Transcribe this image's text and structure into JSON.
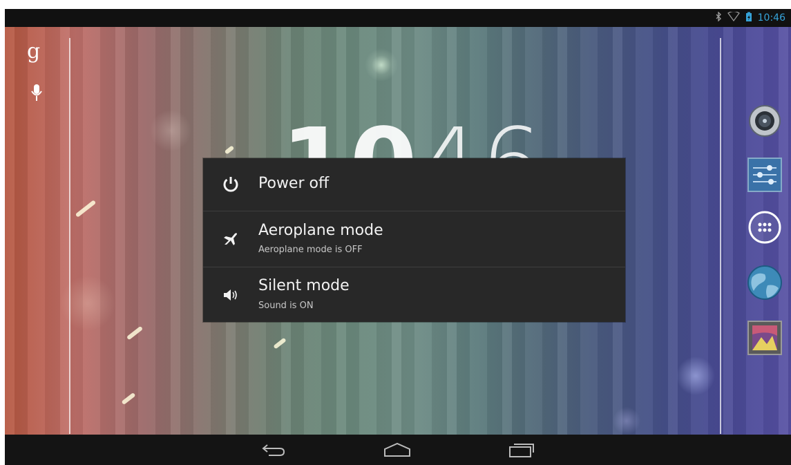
{
  "status_bar": {
    "time": "10:46",
    "icons": [
      "bluetooth-icon",
      "wifi-icon",
      "battery-icon"
    ]
  },
  "home": {
    "clock_hours": "10",
    "clock_minutes": "46",
    "search_letter": "g",
    "left_icons": [
      "google-search-icon",
      "voice-search-icon"
    ],
    "dock_icons": [
      "music-icon",
      "settings-icon",
      "app-drawer-icon",
      "browser-icon",
      "gallery-icon"
    ]
  },
  "power_dialog": {
    "items": [
      {
        "title": "Power off",
        "subtitle": "",
        "icon": "power-icon"
      },
      {
        "title": "Aeroplane mode",
        "subtitle": "Aeroplane mode is OFF",
        "icon": "airplane-icon"
      },
      {
        "title": "Silent mode",
        "subtitle": "Sound is ON",
        "icon": "speaker-icon"
      }
    ]
  },
  "nav_bar": {
    "buttons": [
      "back-icon",
      "home-icon",
      "recent-apps-icon"
    ]
  },
  "colors": {
    "status_accent": "#36a3d9",
    "dialog_bg": "#282828"
  }
}
